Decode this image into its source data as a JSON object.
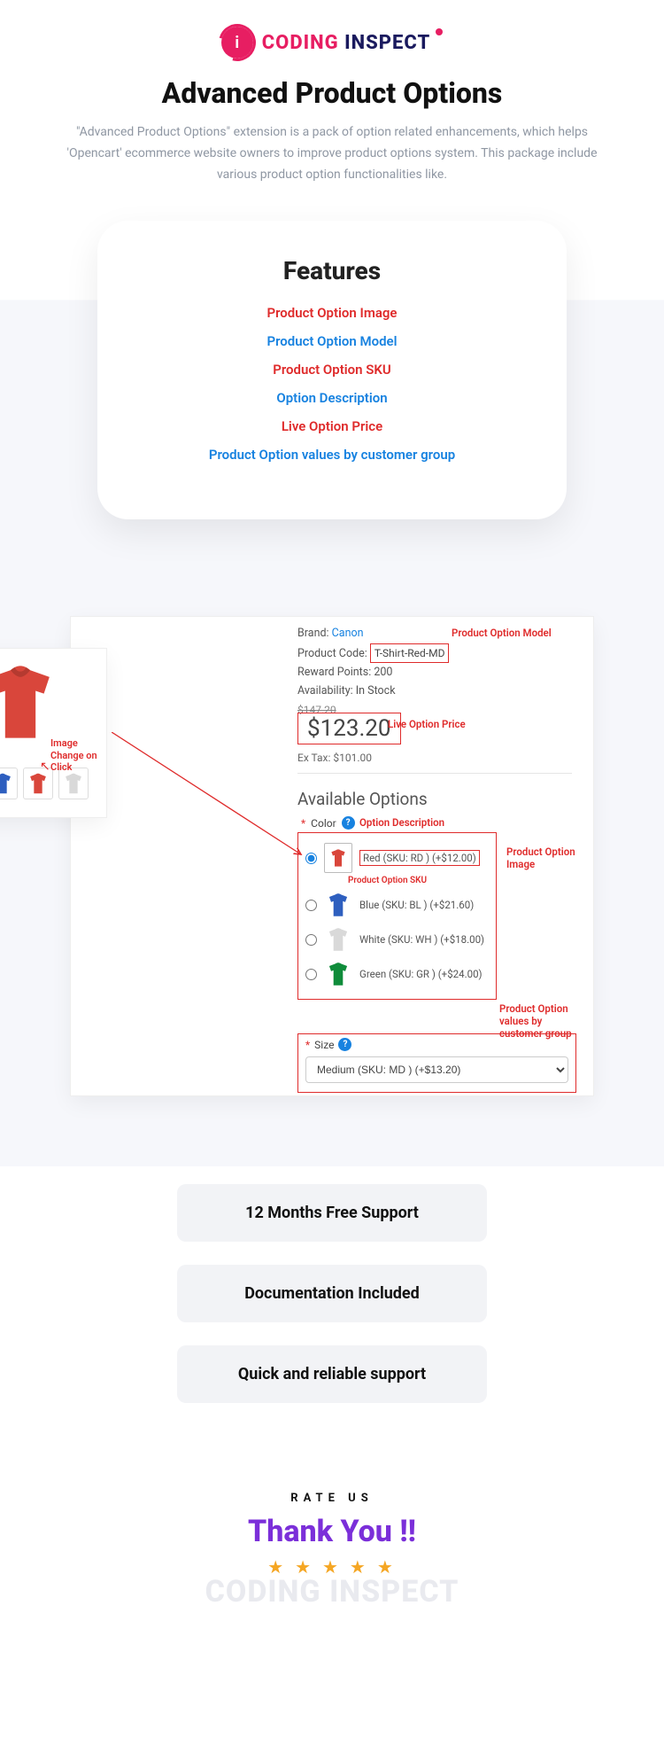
{
  "logo": {
    "coding": "CODING",
    "inspect": "INSPECT"
  },
  "hero": {
    "title": "Advanced Product Options",
    "desc": "\"Advanced Product Options\" extension is a pack of option related enhancements, which helps 'Opencart' ecommerce website owners to improve product options system. This package include various product option functionalities like."
  },
  "features": {
    "title": "Features",
    "items": [
      {
        "label": "Product Option Image",
        "color": "red"
      },
      {
        "label": "Product Option Model",
        "color": "blue"
      },
      {
        "label": "Product Option SKU",
        "color": "red"
      },
      {
        "label": "Option Description",
        "color": "blue"
      },
      {
        "label": "Live Option Price",
        "color": "red"
      },
      {
        "label": "Product Option values by customer group",
        "color": "blue"
      }
    ]
  },
  "diagram": {
    "brand_label": "Brand:",
    "brand_value": "Canon",
    "code_label": "Product Code:",
    "code_value": "T-Shirt-Red-MD",
    "reward_label": "Reward Points: 200",
    "avail_label": "Availability: In Stock",
    "old_price": "$147.20",
    "price": "$123.20",
    "extax": "Ex Tax: $101.00",
    "avail_title": "Available Options",
    "color_label": "Color",
    "size_label": "Size",
    "size_value": "Medium (SKU: MD ) (+$13.20)",
    "sku_anno": "Product Option SKU",
    "colors": [
      {
        "label": "Red (SKU: RD ) (+$12.00)",
        "fill": "#d9463b",
        "checked": true,
        "framed": true
      },
      {
        "label": "Blue (SKU: BL ) (+$21.60)",
        "fill": "#2e5fbf",
        "checked": false,
        "framed": false
      },
      {
        "label": "White (SKU: WH ) (+$18.00)",
        "fill": "#d9d9d9",
        "checked": false,
        "framed": false
      },
      {
        "label": "Green (SKU: GR ) (+$24.00)",
        "fill": "#0f8c3a",
        "checked": false,
        "framed": false
      }
    ],
    "annos": {
      "model": "Product Option Model",
      "liveprice": "Live Option Price",
      "optdesc": "Option Description",
      "img": "Product Option Image",
      "custgrp": "Product Option values by customer group",
      "side": "Image Change on Click"
    },
    "side_thumbs": [
      "#0f8c3a",
      "#2e5fbf",
      "#d9463b",
      "#d9d9d9"
    ]
  },
  "support": [
    "12 Months Free Support",
    "Documentation Included",
    "Quick and reliable support"
  ],
  "rate": {
    "label": "RATE US",
    "thanks": "Thank You !!",
    "ghost": "CODING INSPECT",
    "stars": "★ ★ ★ ★ ★"
  }
}
